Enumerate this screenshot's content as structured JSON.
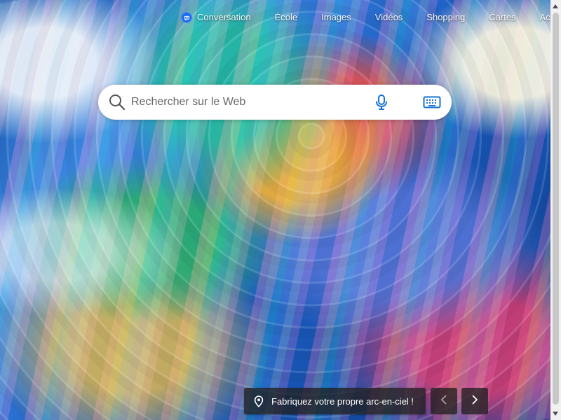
{
  "navigation": {
    "items": [
      {
        "label": "Conversation",
        "icon": "chat-icon"
      },
      {
        "label": "École"
      },
      {
        "label": "Images"
      },
      {
        "label": "Vidéos"
      },
      {
        "label": "Shopping"
      },
      {
        "label": "Cartes"
      },
      {
        "label": "Ac"
      }
    ]
  },
  "search": {
    "placeholder": "Rechercher sur le Web",
    "value": "",
    "icons": {
      "search": "search-icon",
      "mic": "mic-icon",
      "keyboard": "keyboard-icon"
    }
  },
  "background_caption": {
    "text": "Fabriquez votre propre arc-en-ciel !",
    "icon": "location-icon"
  },
  "carousel": {
    "prev_icon": "chevron-left-icon",
    "next_icon": "chevron-right-icon"
  },
  "colors": {
    "search_background": "#ffffff",
    "accent_blue": "#1e6cf0",
    "caption_background": "#202020",
    "scrollbar_track": "#f1f1f1",
    "scrollbar_thumb": "#c8c8c8"
  }
}
